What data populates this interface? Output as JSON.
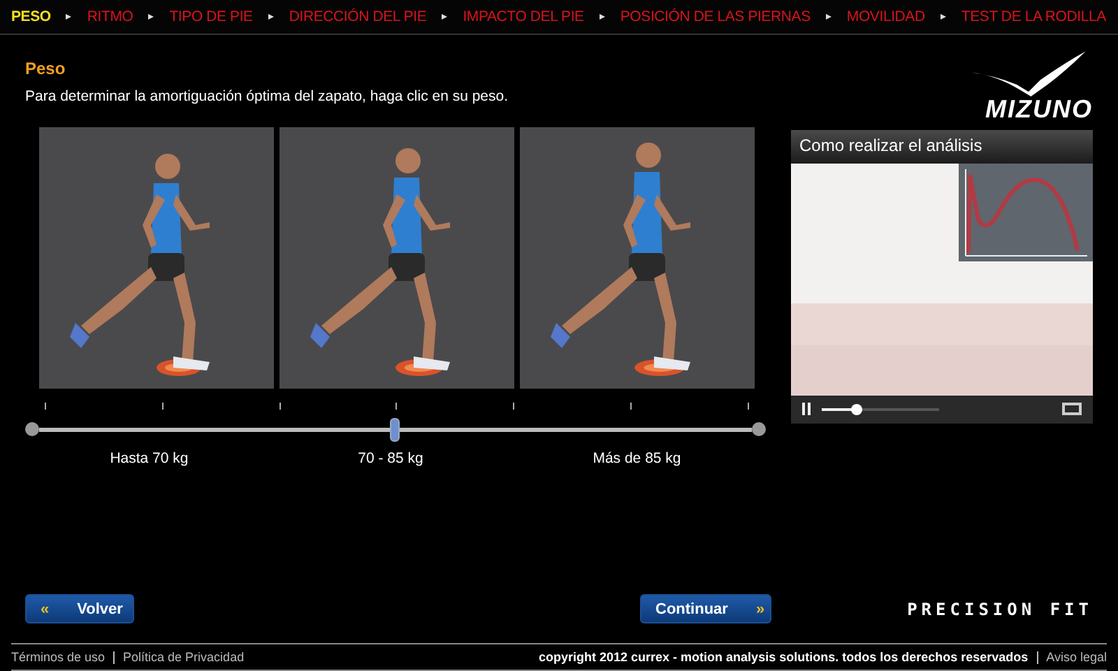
{
  "nav": [
    {
      "label": "PESO",
      "selected": true
    },
    {
      "label": "RITMO",
      "selected": false
    },
    {
      "label": "TIPO DE PIE",
      "selected": false
    },
    {
      "label": "DIRECCIÓN DEL PIE",
      "selected": false
    },
    {
      "label": "IMPACTO DEL PIE",
      "selected": false
    },
    {
      "label": "POSICIÓN DE LAS PIERNAS",
      "selected": false
    },
    {
      "label": "MOVILIDAD",
      "selected": false
    },
    {
      "label": "TEST DE LA RODILLA",
      "selected": false
    }
  ],
  "heading": "Peso",
  "instruction": "Para determinar la amortiguación óptima del zapato, haga clic en su peso.",
  "brand": "MIZUNO",
  "options": [
    {
      "label": "Hasta 70 kg"
    },
    {
      "label": "70 - 85 kg"
    },
    {
      "label": "Más de 85 kg"
    }
  ],
  "slider": {
    "level": 0.5
  },
  "video": {
    "title": "Como realizar el análisis",
    "playing": true,
    "level": 0.3
  },
  "buttons": {
    "back": "Volver",
    "back_icon": "«",
    "next": "Continuar",
    "next_icon": "»"
  },
  "tagline": "PRECISION FIT",
  "footer": {
    "left": [
      {
        "label": "Términos de uso"
      },
      {
        "label": "Política de Privacidad"
      }
    ],
    "copyright": "copyright 2012 currex - motion analysis solutions. todos los derechos reservados",
    "right": "Aviso legal"
  }
}
